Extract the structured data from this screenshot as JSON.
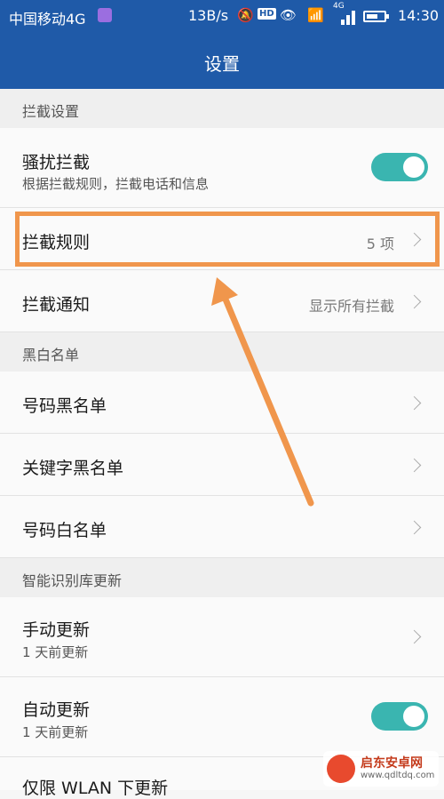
{
  "status_bar": {
    "carrier": "中国移动4G",
    "speed": "13B/s",
    "hd_badge": "HD",
    "network": "4G",
    "time": "14:30"
  },
  "header": {
    "title": "设置"
  },
  "sections": {
    "intercept": "拦截设置",
    "blackwhite": "黑白名单",
    "library": "智能识别库更新"
  },
  "rows": {
    "harass": {
      "label": "骚扰拦截",
      "sub": "根据拦截规则，拦截电话和信息",
      "toggle_on": true
    },
    "rules": {
      "label": "拦截规则",
      "value": "5 项"
    },
    "notify": {
      "label": "拦截通知",
      "value": "显示所有拦截"
    },
    "number_black": {
      "label": "号码黑名单"
    },
    "keyword_black": {
      "label": "关键字黑名单"
    },
    "number_white": {
      "label": "号码白名单"
    },
    "manual_update": {
      "label": "手动更新",
      "sub": "1 天前更新"
    },
    "auto_update": {
      "label": "自动更新",
      "sub": "1 天前更新",
      "toggle_on": true
    },
    "wlan_only": {
      "label": "仅限 WLAN 下更新"
    }
  },
  "watermark": {
    "name": "启东安卓网",
    "url": "www.qdltdq.com"
  },
  "colors": {
    "header": "#1f5aa8",
    "toggle": "#3ab5b0",
    "annotation": "#f0964c"
  }
}
